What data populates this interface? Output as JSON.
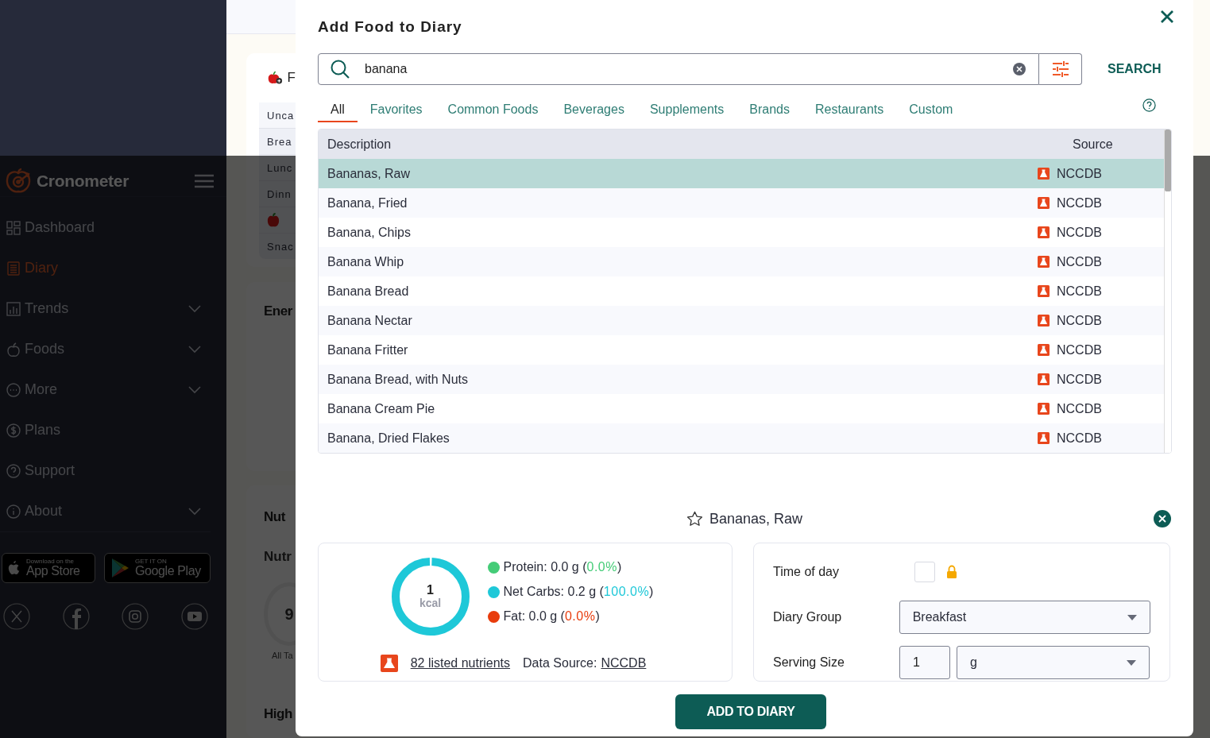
{
  "sidebar": {
    "brand": "Cronometer",
    "nav": [
      {
        "label": "Dashboard",
        "kind": "link",
        "selected": false
      },
      {
        "label": "Diary",
        "kind": "link",
        "selected": true
      },
      {
        "label": "Trends",
        "kind": "group",
        "selected": false
      },
      {
        "label": "Foods",
        "kind": "group",
        "selected": false
      },
      {
        "label": "More",
        "kind": "group",
        "selected": false
      },
      {
        "label": "Plans",
        "kind": "link",
        "selected": false
      },
      {
        "label": "Support",
        "kind": "link",
        "selected": false
      },
      {
        "label": "About",
        "kind": "group",
        "selected": false
      }
    ],
    "store_badges": [
      {
        "kind": "apple",
        "small": "Download on the",
        "big": "App Store"
      },
      {
        "kind": "google",
        "small": "GET IT ON",
        "big": "Google Play"
      }
    ]
  },
  "background": {
    "diary_card": {
      "title": "F",
      "groups": [
        {
          "kind": "text",
          "label": "Unca"
        },
        {
          "kind": "text",
          "label": "Brea"
        },
        {
          "kind": "text",
          "label": "Lunc"
        },
        {
          "kind": "text",
          "label": "Dinn"
        },
        {
          "kind": "apple"
        },
        {
          "kind": "text",
          "label": "Snac"
        }
      ]
    },
    "energy_title": "Ener",
    "nutrition_title": "Nut",
    "nutrition_subtitle": "Nutr",
    "ring_value": "9",
    "ring_label": "All Ta",
    "highlights_title": "High"
  },
  "modal": {
    "title": "Add Food to Diary",
    "search": {
      "value": "banana"
    },
    "search_button": "SEARCH",
    "tabs": [
      {
        "label": "All",
        "selected": true
      },
      {
        "label": "Favorites",
        "selected": false
      },
      {
        "label": "Common Foods",
        "selected": false
      },
      {
        "label": "Beverages",
        "selected": false
      },
      {
        "label": "Supplements",
        "selected": false
      },
      {
        "label": "Brands",
        "selected": false
      },
      {
        "label": "Restaurants",
        "selected": false
      },
      {
        "label": "Custom",
        "selected": false
      }
    ],
    "table": {
      "columns": [
        "Description",
        "Source"
      ],
      "rows": [
        {
          "description": "Bananas, Raw",
          "source": "NCCDB",
          "selected": true
        },
        {
          "description": "Banana, Fried",
          "source": "NCCDB",
          "selected": false
        },
        {
          "description": "Banana, Chips",
          "source": "NCCDB",
          "selected": false
        },
        {
          "description": "Banana Whip",
          "source": "NCCDB",
          "selected": false
        },
        {
          "description": "Banana Bread",
          "source": "NCCDB",
          "selected": false
        },
        {
          "description": "Banana Nectar",
          "source": "NCCDB",
          "selected": false
        },
        {
          "description": "Banana Fritter",
          "source": "NCCDB",
          "selected": false
        },
        {
          "description": "Banana Bread, with Nuts",
          "source": "NCCDB",
          "selected": false
        },
        {
          "description": "Banana Cream Pie",
          "source": "NCCDB",
          "selected": false
        },
        {
          "description": "Banana, Dried Flakes",
          "source": "NCCDB",
          "selected": false
        }
      ]
    },
    "selected_food": {
      "name": "Bananas, Raw",
      "favorite": false
    },
    "summary": {
      "kcal": "1",
      "unit": "kcal",
      "macros": [
        {
          "label": "Protein: 0.0 g (",
          "percent": "0.0%",
          "after": ")",
          "color": "#44cc77"
        },
        {
          "label": "Net Carbs: 0.2 g (",
          "percent": "100.0%",
          "after": ")",
          "color": "#1ec8d8"
        },
        {
          "label": "Fat: 0.0 g (",
          "percent": "0.0%",
          "after": ")",
          "color": "#e83c0c"
        }
      ],
      "nutrients_link": "82 listed nutrients",
      "data_source_label": "Data Source:",
      "data_source": "NCCDB"
    },
    "form": {
      "time_label": "Time of day",
      "time_checked": false,
      "group_label": "Diary Group",
      "group_value": "Breakfast",
      "serving_label": "Serving Size",
      "serving_amount": "1",
      "serving_unit": "g"
    },
    "add_button": "ADD TO DIARY"
  }
}
